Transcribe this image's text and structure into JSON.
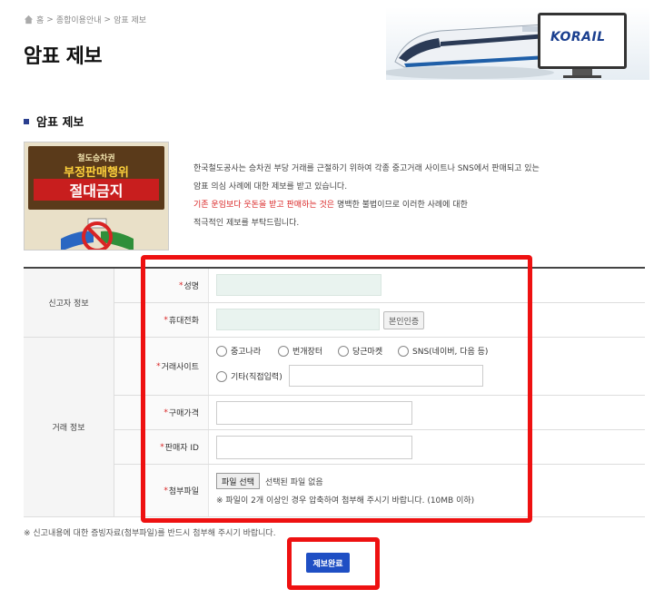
{
  "breadcrumb": {
    "home": "홈",
    "sep": ">",
    "level1": "종합이용안내",
    "level2": "암표 제보"
  },
  "page_title": "암표 제보",
  "logo_text": "KORAIL",
  "section_title": "암표 제보",
  "poster": {
    "small": "철도승차권",
    "line1": "부정판매행위",
    "line2": "절대금지"
  },
  "description": {
    "line1": "한국철도공사는 승차권 부당 거래를 근절하기 위하여 각종 중고거래 사이트나 SNS에서 판매되고 있는",
    "line2": "암표 의심 사례에 대한 제보를 받고 있습니다.",
    "line3_red": "기존 운임보다 웃돈을 받고 판매하는 것은",
    "line3_rest": " 명백한 불법이므로 이러한 사례에 대한",
    "line4": "적극적인 제보를 부탁드립니다."
  },
  "form": {
    "group_reporter": "신고자 정보",
    "group_trade": "거래 정보",
    "required_mark": "*",
    "name_label": "성명",
    "name_value": "",
    "phone_label": "휴대전화",
    "phone_value": "",
    "verify_button": "본인인증",
    "site_label": "거래사이트",
    "site_options": [
      "중고나라",
      "번개장터",
      "당근마켓",
      "SNS(네이버, 다음 등)",
      "기타(직접입력)"
    ],
    "site_other_value": "",
    "price_label": "구매가격",
    "price_value": "",
    "seller_label": "판매자 ID",
    "seller_value": "",
    "attach_label": "첨부파일",
    "file_button": "파일 선택",
    "file_none": "선택된 파일 없음",
    "file_note": "※ 파일이 2개 이상인 경우 압축하여 첨부해 주시기 바랍니다. (10MB 이하)"
  },
  "footnote": "※ 신고내용에 대한 증빙자료(첨부파일)를 반드시 첨부해 주시기 바랍니다.",
  "submit_button": "제보완료",
  "colors": {
    "accent": "#1f4fc4",
    "highlight": "#ee1111",
    "required": "#d92424",
    "field_fill": "#e9f3ef"
  }
}
